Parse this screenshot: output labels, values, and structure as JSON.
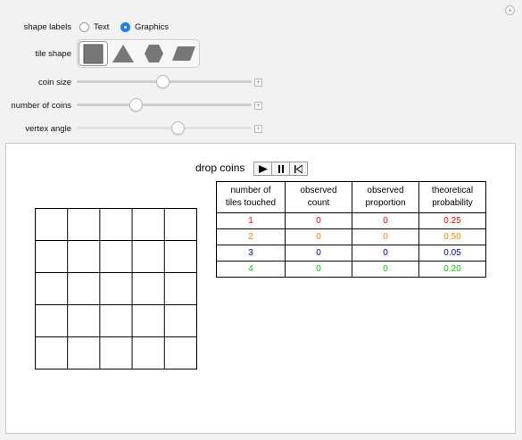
{
  "controls": {
    "shape_labels": {
      "label": "shape labels",
      "options": [
        {
          "label": "Text",
          "selected": false
        },
        {
          "label": "Graphics",
          "selected": true
        }
      ]
    },
    "tile_shape": {
      "label": "tile shape",
      "options": [
        "square-icon",
        "triangle-icon",
        "hexagon-icon",
        "parallelogram-icon"
      ],
      "selected": "square-icon"
    },
    "sliders": [
      {
        "label": "coin size",
        "value_fraction": 0.49
      },
      {
        "label": "number of coins",
        "value_fraction": 0.34
      },
      {
        "label": "vertex angle",
        "value_fraction": 0.58
      }
    ]
  },
  "animation": {
    "label": "drop coins",
    "buttons": [
      "play-icon",
      "pause-icon",
      "reset-icon"
    ]
  },
  "grid": {
    "rows": 5,
    "cols": 5
  },
  "table": {
    "headers": [
      "number of\ntiles touched",
      "observed\ncount",
      "observed\nproportion",
      "theoretical\nprobability"
    ],
    "rows": [
      {
        "cells": [
          "1",
          "0",
          "0",
          "0.25"
        ],
        "color": "#ff0000"
      },
      {
        "cells": [
          "2",
          "0",
          "0",
          "0.50"
        ],
        "color": "#ff8000"
      },
      {
        "cells": [
          "3",
          "0",
          "0",
          "0.05"
        ],
        "color": "#0000cc"
      },
      {
        "cells": [
          "4",
          "0",
          "0",
          "0.20"
        ],
        "color": "#00cc00"
      }
    ]
  }
}
